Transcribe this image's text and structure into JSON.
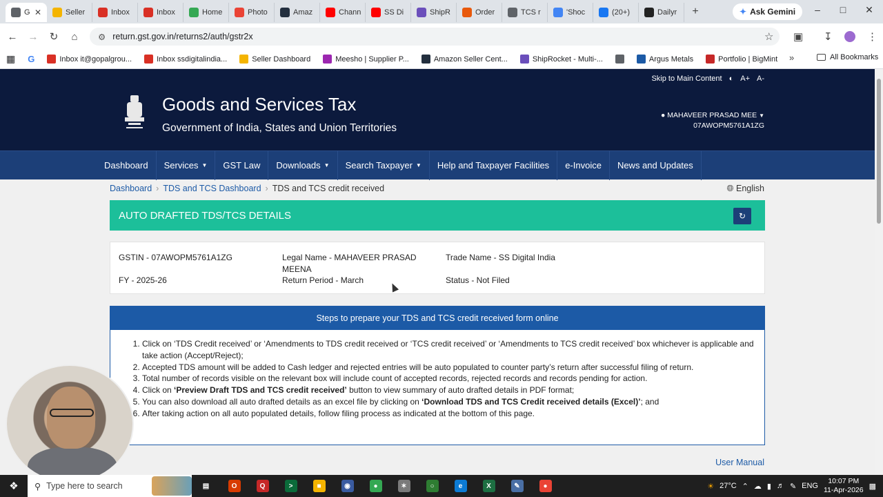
{
  "browser": {
    "tabs": [
      {
        "label": "G",
        "color": "#5f6368",
        "active": true
      },
      {
        "label": "Seller",
        "color": "#f4b400"
      },
      {
        "label": "Inbox",
        "color": "#d93025"
      },
      {
        "label": "Inbox",
        "color": "#d93025"
      },
      {
        "label": "Home",
        "color": "#34a853"
      },
      {
        "label": "Photo",
        "color": "#ea4335"
      },
      {
        "label": "Amaz",
        "color": "#232f3e"
      },
      {
        "label": "Chann",
        "color": "#ff0000"
      },
      {
        "label": "SS Di",
        "color": "#ff0000"
      },
      {
        "label": "ShipR",
        "color": "#6b4fbb"
      },
      {
        "label": "Order",
        "color": "#e8590c"
      },
      {
        "label": "TCS r",
        "color": "#5f6368"
      },
      {
        "label": "'Shoc",
        "color": "#4285f4"
      },
      {
        "label": "(20+)",
        "color": "#1877f2"
      },
      {
        "label": "Dailyr",
        "color": "#222222"
      }
    ],
    "gemini_label": "Ask Gemini",
    "url": "return.gst.gov.in/returns2/auth/gstr2x",
    "bookmarks": [
      {
        "label": "Inbox it@gopalgrou...",
        "color": "#d93025"
      },
      {
        "label": "Inbox ssdigitalindia...",
        "color": "#d93025"
      },
      {
        "label": "Seller Dashboard",
        "color": "#f4b400"
      },
      {
        "label": "Meesho | Supplier P...",
        "color": "#9c27b0"
      },
      {
        "label": "Amazon Seller Cent...",
        "color": "#232f3e"
      },
      {
        "label": "ShipRocket - Multi-...",
        "color": "#6b4fbb"
      },
      {
        "label": "",
        "color": "#5f6368"
      },
      {
        "label": "Argus Metals",
        "color": "#1c5aa6"
      },
      {
        "label": "Portfolio | BigMint",
        "color": "#c62828"
      }
    ],
    "all_bookmarks": "All Bookmarks"
  },
  "header": {
    "skip_link": "Skip to Main Content",
    "font_increase": "A+",
    "font_decrease": "A-",
    "title": "Goods and Services Tax",
    "subtitle": "Government of India, States and Union Territories",
    "user_name": "MAHAVEER PRASAD MEE",
    "user_gstin": "07AWOPM5761A1ZG"
  },
  "nav": [
    {
      "label": "Dashboard",
      "dropdown": false
    },
    {
      "label": "Services",
      "dropdown": true
    },
    {
      "label": "GST Law",
      "dropdown": false
    },
    {
      "label": "Downloads",
      "dropdown": true
    },
    {
      "label": "Search Taxpayer",
      "dropdown": true
    },
    {
      "label": "Help and Taxpayer Facilities",
      "dropdown": false
    },
    {
      "label": "e-Invoice",
      "dropdown": false
    },
    {
      "label": "News and Updates",
      "dropdown": false
    }
  ],
  "breadcrumb": {
    "items": [
      "Dashboard",
      "TDS and TCS Dashboard"
    ],
    "current": "TDS and TCS credit received"
  },
  "language": "English",
  "section_title": "AUTO DRAFTED TDS/TCS DETAILS",
  "info": {
    "gstin": "GSTIN - 07AWOPM5761A1ZG",
    "legal_name_1": "Legal Name - MAHAVEER PRASAD",
    "legal_name_2": "MEENA",
    "trade_name": "Trade Name - SS Digital India",
    "fy": "FY - 2025-26",
    "return_period": "Return Period - March",
    "status": "Status - Not Filed"
  },
  "steps": {
    "heading": "Steps to prepare your TDS and TCS credit received form online",
    "s1": "Click on ‘TDS Credit received’ or ‘Amendments to TDS credit received or ‘TCS credit received’ or ‘Amendments to TCS credit received’ box whichever is applicable and take action (Accept/Reject);",
    "s2": "Accepted TDS amount will be added to Cash ledger and rejected entries will be auto populated to counter party’s return after successful filing of return.",
    "s3": "Total number of records visible on the relevant box will include count of accepted records, rejected records and records pending for action.",
    "s4_pre": "Click on ",
    "s4_bold": "‘Preview Draft TDS and TCS credit received’",
    "s4_post": " button to view summary of auto drafted details in PDF format;",
    "s5_pre": "You can also download all auto drafted details as an excel file by clicking on ",
    "s5_bold": "‘Download TDS and TCS Credit received details (Excel)’",
    "s5_post": "; and",
    "s6": "After taking action on all auto populated details, follow filing process as indicated at the bottom of this page."
  },
  "user_manual": "User Manual",
  "taskbar": {
    "search_placeholder": "Type here to search",
    "temperature": "27°C",
    "language": "ENG",
    "time": "10:07 PM",
    "date": "11-Apr-2026",
    "apps": [
      {
        "name": "task-view",
        "color": "#1f1f1f",
        "glyph": "▤"
      },
      {
        "name": "office",
        "color": "#d83b01",
        "glyph": "O"
      },
      {
        "name": "app-q",
        "color": "#c62828",
        "glyph": "Q"
      },
      {
        "name": "terminal",
        "color": "#0b6b3a",
        "glyph": ">"
      },
      {
        "name": "file-explorer",
        "color": "#f4b400",
        "glyph": "■"
      },
      {
        "name": "app-blue",
        "color": "#3a5ba0",
        "glyph": "◉"
      },
      {
        "name": "chrome",
        "color": "#34a853",
        "glyph": "●"
      },
      {
        "name": "app-tool",
        "color": "#7a7a7a",
        "glyph": "✶"
      },
      {
        "name": "app-green",
        "color": "#2e7d32",
        "glyph": "○"
      },
      {
        "name": "edge",
        "color": "#0c7bd4",
        "glyph": "e"
      },
      {
        "name": "excel",
        "color": "#1d6f42",
        "glyph": "X"
      },
      {
        "name": "app-pen",
        "color": "#4a6fa5",
        "glyph": "✎"
      },
      {
        "name": "chrome-2",
        "color": "#ea4335",
        "glyph": "●"
      }
    ]
  },
  "colors": {
    "header_bg": "#0c1a3d",
    "nav_bg": "#1c3f78",
    "section_green": "#1cbf9a",
    "steps_blue": "#1c5aa6"
  }
}
